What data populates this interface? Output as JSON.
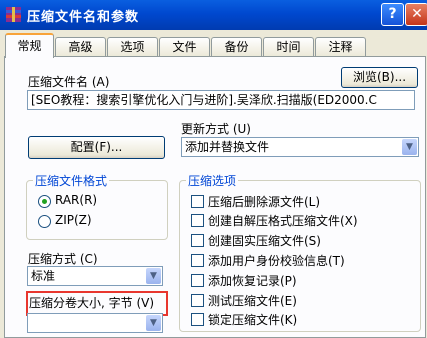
{
  "window": {
    "title": "压缩文件名和参数",
    "help_glyph": "?",
    "close_glyph": "✕"
  },
  "tabs": [
    "常规",
    "高级",
    "选项",
    "文件",
    "备份",
    "时间",
    "注释"
  ],
  "archive_name": {
    "label": "压缩文件名 (A)",
    "browse_label": "浏览(B)...",
    "value": "[SEO教程：搜索引擎优化入门与进阶].吴泽欣.扫描版(ED2000.C"
  },
  "update_mode": {
    "label": "更新方式 (U)",
    "value": "添加并替换文件"
  },
  "profiles_label": "配置(F)...",
  "format": {
    "title": "压缩文件格式",
    "options": [
      "RAR(R)",
      "ZIP(Z)"
    ],
    "selected": "RAR(R)"
  },
  "method": {
    "label": "压缩方式 (C)",
    "value": "标准"
  },
  "volume": {
    "label": "压缩分卷大小, 字节 (V)",
    "value": ""
  },
  "options": {
    "title": "压缩选项",
    "items": [
      "压缩后删除源文件(L)",
      "创建自解压格式压缩文件(X)",
      "创建固实压缩文件(S)",
      "添加用户身份校验信息(T)",
      "添加恢复记录(P)",
      "测试压缩文件(E)",
      "锁定压缩文件(K)"
    ]
  },
  "colors": {
    "accent_red": "#e8362e",
    "group_title": "#0046d5",
    "titlebar": "#0048cf"
  }
}
